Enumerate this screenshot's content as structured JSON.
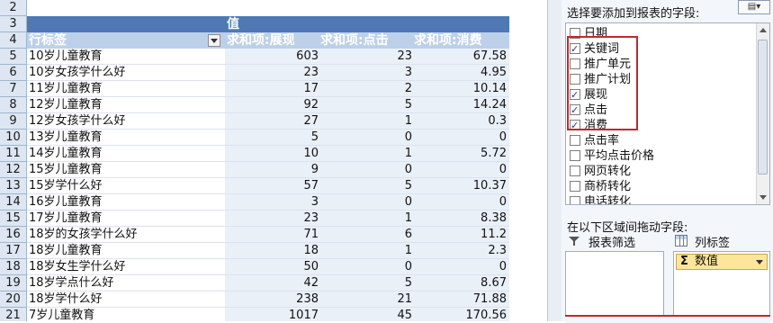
{
  "sheet": {
    "row_numbers": [
      "2",
      "3",
      "4",
      "5",
      "6",
      "7",
      "8",
      "9",
      "10",
      "11",
      "12",
      "13",
      "14",
      "15",
      "16",
      "17",
      "18",
      "19",
      "20",
      "21"
    ],
    "pivot": {
      "values_header": "值",
      "row_label_header": "行标签",
      "col_headers": [
        "求和项:展现",
        "求和项:点击",
        "求和项:消费"
      ],
      "rows": [
        [
          "10岁儿童教育",
          "603",
          "23",
          "67.58"
        ],
        [
          "10岁女孩学什么好",
          "23",
          "3",
          "4.95"
        ],
        [
          "11岁儿童教育",
          "17",
          "2",
          "10.14"
        ],
        [
          "12岁儿童教育",
          "92",
          "5",
          "14.24"
        ],
        [
          "12岁女孩学什么好",
          "27",
          "1",
          "0.3"
        ],
        [
          "13岁儿童教育",
          "5",
          "0",
          "0"
        ],
        [
          "14岁儿童教育",
          "10",
          "1",
          "5.72"
        ],
        [
          "15岁儿童教育",
          "9",
          "0",
          "0"
        ],
        [
          "15岁学什么好",
          "57",
          "5",
          "10.37"
        ],
        [
          "16岁儿童教育",
          "3",
          "0",
          "0"
        ],
        [
          "17岁儿童教育",
          "23",
          "1",
          "8.38"
        ],
        [
          "18岁的女孩学什么好",
          "71",
          "6",
          "11.2"
        ],
        [
          "18岁儿童教育",
          "18",
          "1",
          "2.3"
        ],
        [
          "18岁女生学什么好",
          "50",
          "0",
          "0"
        ],
        [
          "18岁学点什么好",
          "42",
          "5",
          "8.67"
        ],
        [
          "18岁学什么好",
          "238",
          "21",
          "71.88"
        ],
        [
          "7岁儿童教育",
          "1017",
          "45",
          "170.56"
        ]
      ]
    }
  },
  "pane": {
    "title": "选择要添加到报表的字段:",
    "layout_button_icon": "field-list-layout-icon",
    "fields": [
      {
        "label": "日期",
        "checked": false
      },
      {
        "label": "关键词",
        "checked": true
      },
      {
        "label": "推广单元",
        "checked": false
      },
      {
        "label": "推广计划",
        "checked": false
      },
      {
        "label": "展现",
        "checked": true
      },
      {
        "label": "点击",
        "checked": true
      },
      {
        "label": "消费",
        "checked": true
      },
      {
        "label": "点击率",
        "checked": false
      },
      {
        "label": "平均点击价格",
        "checked": false
      },
      {
        "label": "网页转化",
        "checked": false
      },
      {
        "label": "商桥转化",
        "checked": false
      },
      {
        "label": "电话转化",
        "checked": false
      }
    ],
    "drag_title": "在以下区域间拖动字段:",
    "report_filter_label": "报表筛选",
    "column_labels_label": "列标签",
    "values_chip": {
      "symbol": "Σ",
      "label": "数值"
    }
  },
  "colors": {
    "pivot_header": "#4f79b5",
    "highlight_box": "#c3282e"
  }
}
